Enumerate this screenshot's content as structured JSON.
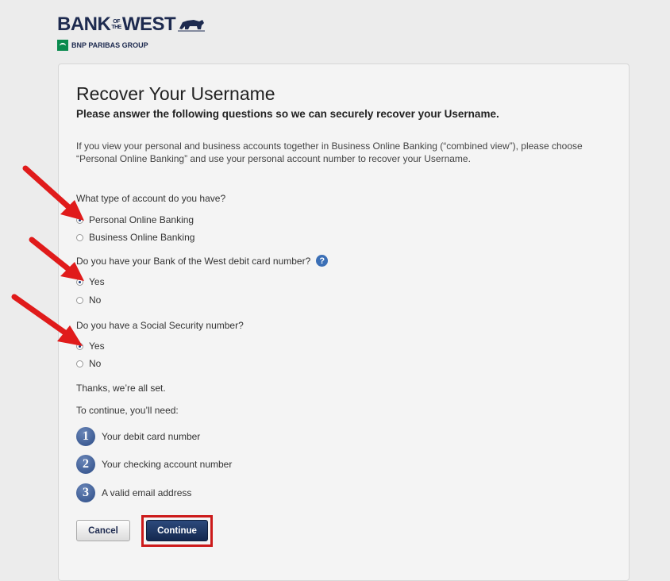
{
  "brand": {
    "name_left": "BANK",
    "name_of": "OF",
    "name_the": "THE",
    "name_right": "WEST",
    "group": "BNP PARIBAS GROUP",
    "primary_color": "#1d2a4f",
    "group_color": "#0a8a4e"
  },
  "page": {
    "title": "Recover Your Username",
    "subtitle": "Please answer the following questions so we can securely recover your Username.",
    "notice": "If you view your personal and business accounts together in Business Online Banking (“combined view”), please choose “Personal Online Banking” and use your personal account number to recover your Username."
  },
  "questions": [
    {
      "label": "What type of account do you have?",
      "options": [
        "Personal Online Banking",
        "Business Online Banking"
      ],
      "selected": "Personal Online Banking"
    },
    {
      "label": "Do you have your Bank of the West debit card number?",
      "help_icon": "question-icon",
      "options": [
        "Yes",
        "No"
      ],
      "selected": "Yes"
    },
    {
      "label": "Do you have a Social Security number?",
      "options": [
        "Yes",
        "No"
      ],
      "selected": "Yes"
    }
  ],
  "summary": {
    "done": "Thanks, we’re all set.",
    "need_intro": "To continue, you’ll need:",
    "steps": [
      {
        "num": "1",
        "text": "Your debit card number"
      },
      {
        "num": "2",
        "text": "Your checking account number"
      },
      {
        "num": "3",
        "text": "A valid email address"
      }
    ]
  },
  "buttons": {
    "cancel": "Cancel",
    "continue": "Continue"
  },
  "annotation_color": "#e01b1b"
}
